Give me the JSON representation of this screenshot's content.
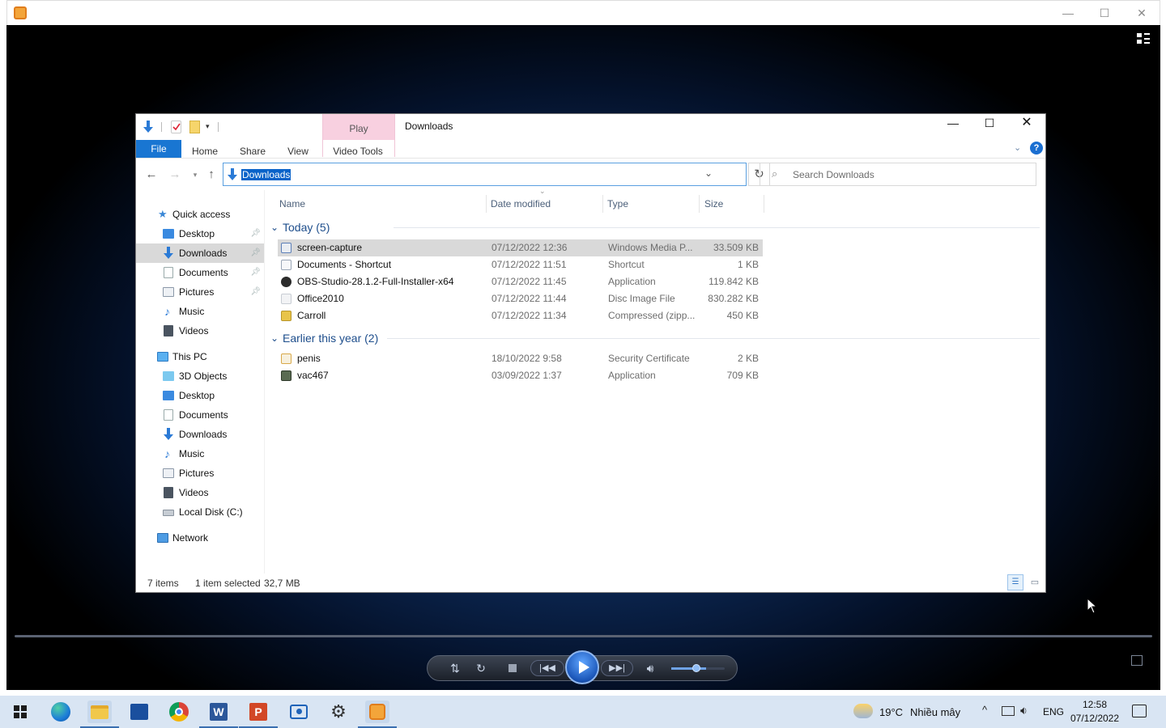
{
  "player": {
    "window_controls": {
      "minimize": "—",
      "maximize": "☐",
      "close": "✕"
    },
    "switch_icon": "switch-to-library-icon",
    "controls": {
      "shuffle": "shuffle-icon",
      "repeat": "repeat-icon",
      "stop": "stop-icon",
      "prev": "previous-icon",
      "play": "play-icon",
      "next": "next-icon",
      "mute": "volume-icon",
      "volume": 0.65
    }
  },
  "explorer": {
    "title": "Downloads",
    "context_tab": "Play",
    "tabs": {
      "file": "File",
      "home": "Home",
      "share": "Share",
      "view": "View",
      "video_tools": "Video Tools"
    },
    "address": "Downloads",
    "search_placeholder": "Search Downloads",
    "columns": {
      "name": "Name",
      "date": "Date modified",
      "type": "Type",
      "size": "Size"
    },
    "groups": [
      {
        "label": "Today (5)"
      },
      {
        "label": "Earlier this year (2)"
      }
    ],
    "files": [
      {
        "name": "screen-capture",
        "date": "07/12/2022 12:36",
        "type": "Windows Media P...",
        "size": "33.509 KB",
        "color": "#5c7fb8"
      },
      {
        "name": "Documents - Shortcut",
        "date": "07/12/2022 11:51",
        "type": "Shortcut",
        "size": "1 KB",
        "color": "#9aa6b6"
      },
      {
        "name": "OBS-Studio-28.1.2-Full-Installer-x64",
        "date": "07/12/2022 11:45",
        "type": "Application",
        "size": "119.842 KB",
        "color": "#2b2b2b"
      },
      {
        "name": "Office2010",
        "date": "07/12/2022 11:44",
        "type": "Disc Image File",
        "size": "830.282 KB",
        "color": "#c8cdd4"
      },
      {
        "name": "Carroll",
        "date": "07/12/2022 11:34",
        "type": "Compressed (zipp...",
        "size": "450 KB",
        "color": "#e8c44a"
      },
      {
        "name": "penis",
        "date": "18/10/2022 9:58",
        "type": "Security Certificate",
        "size": "2 KB",
        "color": "#d8a94a"
      },
      {
        "name": "vac467",
        "date": "03/09/2022 1:37",
        "type": "Application",
        "size": "709 KB",
        "color": "#5a6b52"
      }
    ],
    "sidebar": {
      "quick_access": "Quick access",
      "qa_items": [
        "Desktop",
        "Downloads",
        "Documents",
        "Pictures",
        "Music",
        "Videos"
      ],
      "this_pc": "This PC",
      "pc_items": [
        "3D Objects",
        "Desktop",
        "Documents",
        "Downloads",
        "Music",
        "Pictures",
        "Videos",
        "Local Disk (C:)"
      ],
      "network": "Network"
    },
    "status": {
      "count": "7 items",
      "selected": "1 item selected",
      "size": "32,7 MB"
    }
  },
  "taskbar": {
    "weather_temp": "19°C",
    "weather_desc": "Nhiều mây",
    "lang": "ENG",
    "time": "12:58",
    "date": "07/12/2022"
  }
}
